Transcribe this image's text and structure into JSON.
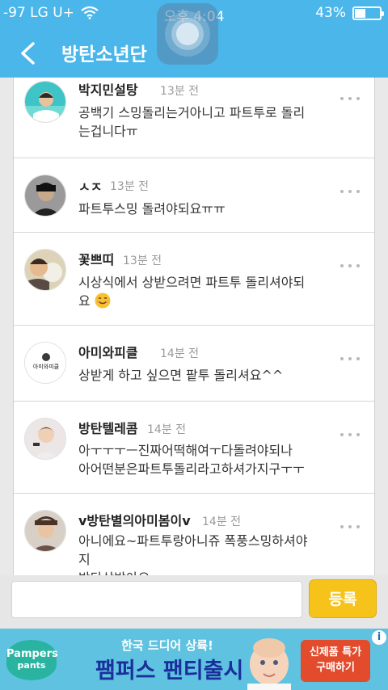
{
  "status_bar": {
    "signal": "-97 LG U+",
    "time": "오후 4:04",
    "battery": "43%"
  },
  "header": {
    "title": "방탄소년단"
  },
  "comments": [
    {
      "author": "박지민설탕",
      "time": "13분 전",
      "lines": [
        "공백기 스밍돌리는거아니고 파트투로 돌리",
        "는겁니다ㅠ"
      ]
    },
    {
      "author": "ㅅㅈ",
      "time": "13분 전",
      "lines": [
        "파트투스밍 돌려야되요ㅠㅠ"
      ]
    },
    {
      "author": "꽃쁘띠",
      "time": "13분 전",
      "lines": [
        "시상식에서 상받으려면 파트투 돌리셔야되",
        "요"
      ]
    },
    {
      "author": "아미와피클",
      "time": "14분 전",
      "lines": [
        "상받게 하고 싶으면 팥투 돌리셔요^^"
      ],
      "avatar_text": "아미와피클"
    },
    {
      "author": "방탄텔레콤",
      "time": "14분 전",
      "lines": [
        "아ㅜㅜㅜㅡ진짜어떡해여ㅜ다돌려야되나",
        "아어떤분은파트투돌리라고하셔가지구ㅜㅜ"
      ]
    },
    {
      "author": "v방탄별의아미봄이v",
      "time": "14분 전",
      "lines": [
        "아니에요~파트투랑아니쥬 폭풍스밍하셔야",
        "지",
        "방탄상받아요"
      ]
    }
  ],
  "input": {
    "placeholder": "",
    "submit_label": "등록"
  },
  "ad": {
    "brand_line1": "Pampers",
    "brand_line2": "pants",
    "tagline": "한국 드디어 상륙!",
    "headline": "팸퍼스 팬티출시",
    "cta_line1": "신제품 특가",
    "cta_line2": "구매하기",
    "info": "i"
  },
  "colors": {
    "header": "#4ab6ea",
    "submit": "#f6c31a",
    "ad_background": "#5ec2e0"
  },
  "icons": [
    "back-icon",
    "wifi-icon",
    "battery-icon",
    "more-icon",
    "smiley-icon",
    "info-icon"
  ]
}
